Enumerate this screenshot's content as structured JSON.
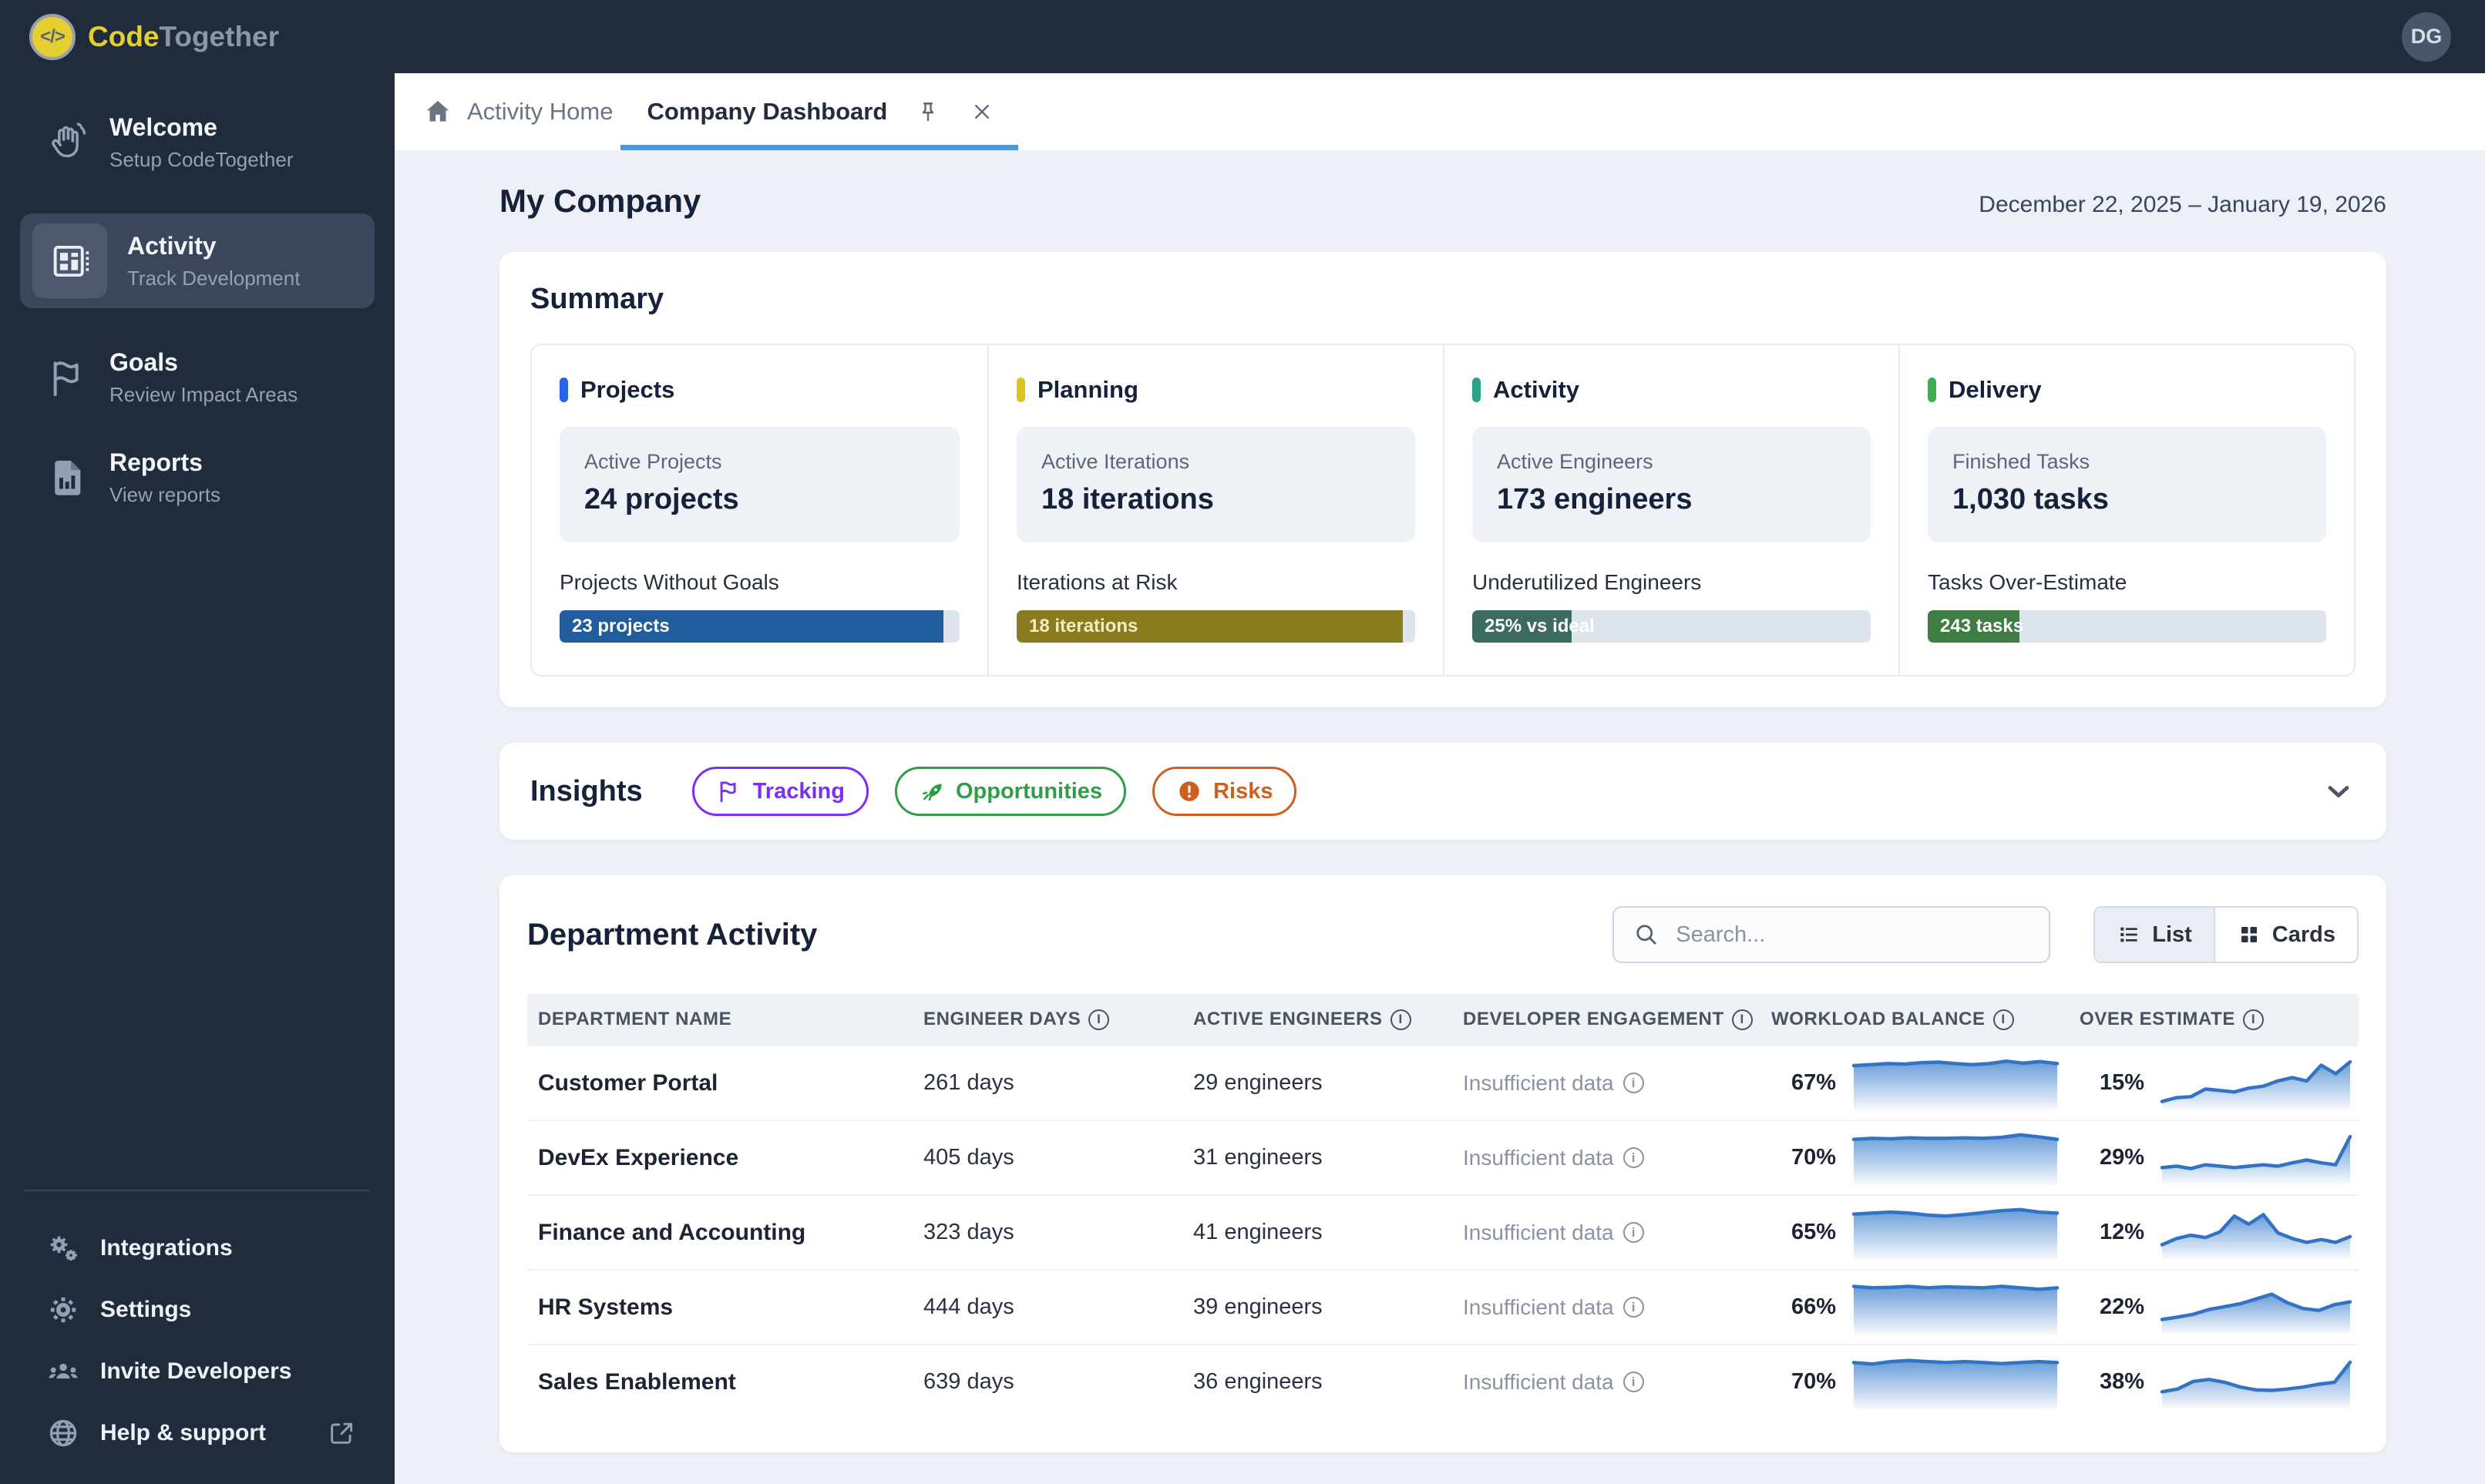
{
  "topbar": {
    "logo_mark": "</>",
    "logo_code": "Code",
    "logo_together": "Together",
    "avatar_initials": "DG"
  },
  "tabs": {
    "home_label": "Activity Home",
    "active_label": "Company Dashboard"
  },
  "sidebar": {
    "items": [
      {
        "label": "Welcome",
        "sub": "Setup CodeTogether"
      },
      {
        "label": "Activity",
        "sub": "Track Development"
      },
      {
        "label": "Goals",
        "sub": "Review Impact Areas"
      },
      {
        "label": "Reports",
        "sub": "View reports"
      }
    ],
    "footer_items": [
      {
        "label": "Integrations"
      },
      {
        "label": "Settings"
      },
      {
        "label": "Invite Developers"
      },
      {
        "label": "Help & support"
      }
    ]
  },
  "page": {
    "title": "My Company",
    "date_range": "December 22, 2025 – January 19, 2026"
  },
  "summary": {
    "title": "Summary",
    "cards": [
      {
        "name": "Projects",
        "accent": "#2563eb",
        "stat_label": "Active Projects",
        "stat_value": "24 projects",
        "bar_title": "Projects Without Goals",
        "bar_text": "23 projects",
        "bar_text_color": "#ffffff",
        "bar_color": "#215c9d",
        "bar_pct": 96
      },
      {
        "name": "Planning",
        "accent": "#d9c625",
        "stat_label": "Active Iterations",
        "stat_value": "18 iterations",
        "bar_title": "Iterations at Risk",
        "bar_text": "18 iterations",
        "bar_text_color": "#f2ecc2",
        "bar_color": "#8b7b1f",
        "bar_pct": 97
      },
      {
        "name": "Activity",
        "accent": "#2aa188",
        "stat_label": "Active Engineers",
        "stat_value": "173 engineers",
        "bar_title": "Underutilized Engineers",
        "bar_text": "25% vs ideal",
        "bar_text_color": "#ffffff",
        "bar_color": "#3c6b5f",
        "bar_pct": 25
      },
      {
        "name": "Delivery",
        "accent": "#3cae54",
        "stat_label": "Finished Tasks",
        "stat_value": "1,030 tasks",
        "bar_title": "Tasks Over-Estimate",
        "bar_text": "243 tasks",
        "bar_text_color": "#ffffff",
        "bar_color": "#3f7d45",
        "bar_pct": 23
      }
    ]
  },
  "insights": {
    "title": "Insights",
    "buttons": [
      {
        "label": "Tracking",
        "color": "#7a2ff2",
        "icon": "flag-icon"
      },
      {
        "label": "Opportunities",
        "color": "#2f9e44",
        "icon": "rocket-icon"
      },
      {
        "label": "Risks",
        "color": "#d05f1e",
        "icon": "alert-icon"
      }
    ]
  },
  "departments": {
    "title": "Department Activity",
    "search_placeholder": "Search...",
    "view_toggle": {
      "list": "List",
      "cards": "Cards"
    },
    "columns": [
      "Department Name",
      "Engineer Days",
      "Active Engineers",
      "Developer Engagement",
      "Workload Balance",
      "Over Estimate"
    ],
    "rows": [
      {
        "name": "Customer Portal",
        "days": "261 days",
        "engineers": "29 engineers",
        "engagement": "Insufficient data",
        "workload_pct": "67%",
        "over_pct": "15%",
        "workload_spark": [
          0.86,
          0.88,
          0.9,
          0.89,
          0.92,
          0.93,
          0.9,
          0.88,
          0.9,
          0.95,
          0.91,
          0.94,
          0.9
        ],
        "over_spark": [
          0.12,
          0.2,
          0.22,
          0.38,
          0.35,
          0.32,
          0.4,
          0.44,
          0.55,
          0.62,
          0.55,
          0.88,
          0.7,
          0.95
        ]
      },
      {
        "name": "DevEx Experience",
        "days": "405 days",
        "engineers": "31 engineers",
        "engagement": "Insufficient data",
        "workload_pct": "70%",
        "over_pct": "29%",
        "workload_spark": [
          0.88,
          0.9,
          0.89,
          0.91,
          0.9,
          0.9,
          0.91,
          0.9,
          0.92,
          0.97,
          0.93,
          0.88
        ],
        "over_spark": [
          0.3,
          0.33,
          0.28,
          0.36,
          0.33,
          0.3,
          0.33,
          0.36,
          0.33,
          0.4,
          0.46,
          0.4,
          0.36,
          0.95
        ]
      },
      {
        "name": "Finance and Accounting",
        "days": "323 days",
        "engineers": "41 engineers",
        "engagement": "Insufficient data",
        "workload_pct": "65%",
        "over_pct": "12%",
        "workload_spark": [
          0.88,
          0.9,
          0.92,
          0.9,
          0.86,
          0.84,
          0.87,
          0.91,
          0.95,
          0.97,
          0.92,
          0.9
        ],
        "over_spark": [
          0.25,
          0.38,
          0.45,
          0.4,
          0.52,
          0.85,
          0.68,
          0.88,
          0.5,
          0.38,
          0.3,
          0.36,
          0.3,
          0.42
        ]
      },
      {
        "name": "HR Systems",
        "days": "444 days",
        "engineers": "39 engineers",
        "engagement": "Insufficient data",
        "workload_pct": "66%",
        "over_pct": "22%",
        "workload_spark": [
          0.93,
          0.9,
          0.91,
          0.93,
          0.9,
          0.92,
          0.91,
          0.9,
          0.93,
          0.9,
          0.87,
          0.9
        ],
        "over_spark": [
          0.25,
          0.3,
          0.36,
          0.46,
          0.52,
          0.58,
          0.68,
          0.78,
          0.6,
          0.48,
          0.44,
          0.56,
          0.62
        ]
      },
      {
        "name": "Sales Enablement",
        "days": "639 days",
        "engineers": "36 engineers",
        "engagement": "Insufficient data",
        "workload_pct": "70%",
        "over_pct": "38%",
        "workload_spark": [
          0.9,
          0.87,
          0.92,
          0.94,
          0.92,
          0.9,
          0.92,
          0.9,
          0.88,
          0.9,
          0.92,
          0.9
        ],
        "over_spark": [
          0.3,
          0.36,
          0.52,
          0.56,
          0.5,
          0.4,
          0.34,
          0.33,
          0.36,
          0.4,
          0.46,
          0.5,
          0.92
        ]
      }
    ]
  }
}
